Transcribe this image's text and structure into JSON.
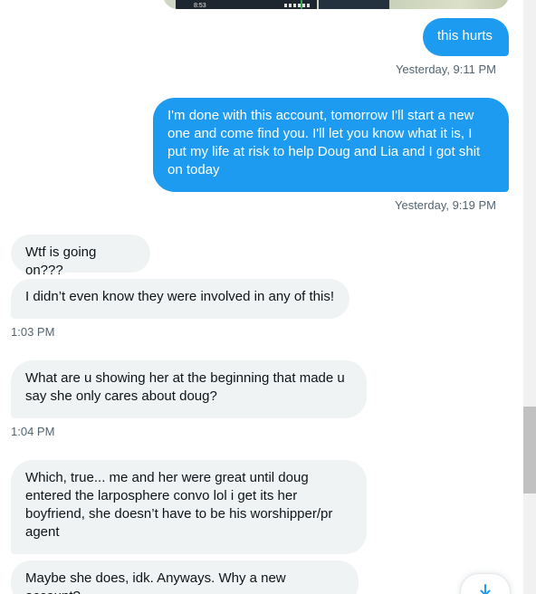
{
  "attachment": {
    "status_time": "8:53"
  },
  "messages": [
    {
      "id": "m1",
      "dir": "out",
      "text": "this hurts"
    },
    {
      "id": "m2",
      "dir": "out",
      "text": "I'm done with this account, tomorrow I'll start a new one and come find you. I'll let you know what it is, I put my life at risk to help Doug and Lia and I got shit on today"
    },
    {
      "id": "m3",
      "dir": "in",
      "text": "Wtf is going on???"
    },
    {
      "id": "m4",
      "dir": "in",
      "text": "I didn’t even know they were involved in any of this!"
    },
    {
      "id": "m5",
      "dir": "in",
      "text": "What are u showing her at the beginning that made u say she only cares about doug?"
    },
    {
      "id": "m6",
      "dir": "in",
      "text": "Which, true... me and her were great until doug entered the larposphere convo lol i get its her boyfriend, she doesn’t have to be his worshipper/pr agent"
    },
    {
      "id": "m7",
      "dir": "in",
      "text": "Maybe she does, idk. Anyways. Why a new account?"
    }
  ],
  "timestamps": {
    "t1": "Yesterday, 9:11 PM",
    "t2": "Yesterday, 9:19 PM",
    "t3": "1:03 PM",
    "t4": "1:04 PM"
  },
  "colors": {
    "outgoing_bubble": "#1d9bf0",
    "incoming_bubble": "#eff3f4",
    "timestamp": "#536471"
  },
  "icons": {
    "scroll_down": "arrow-down-icon"
  }
}
